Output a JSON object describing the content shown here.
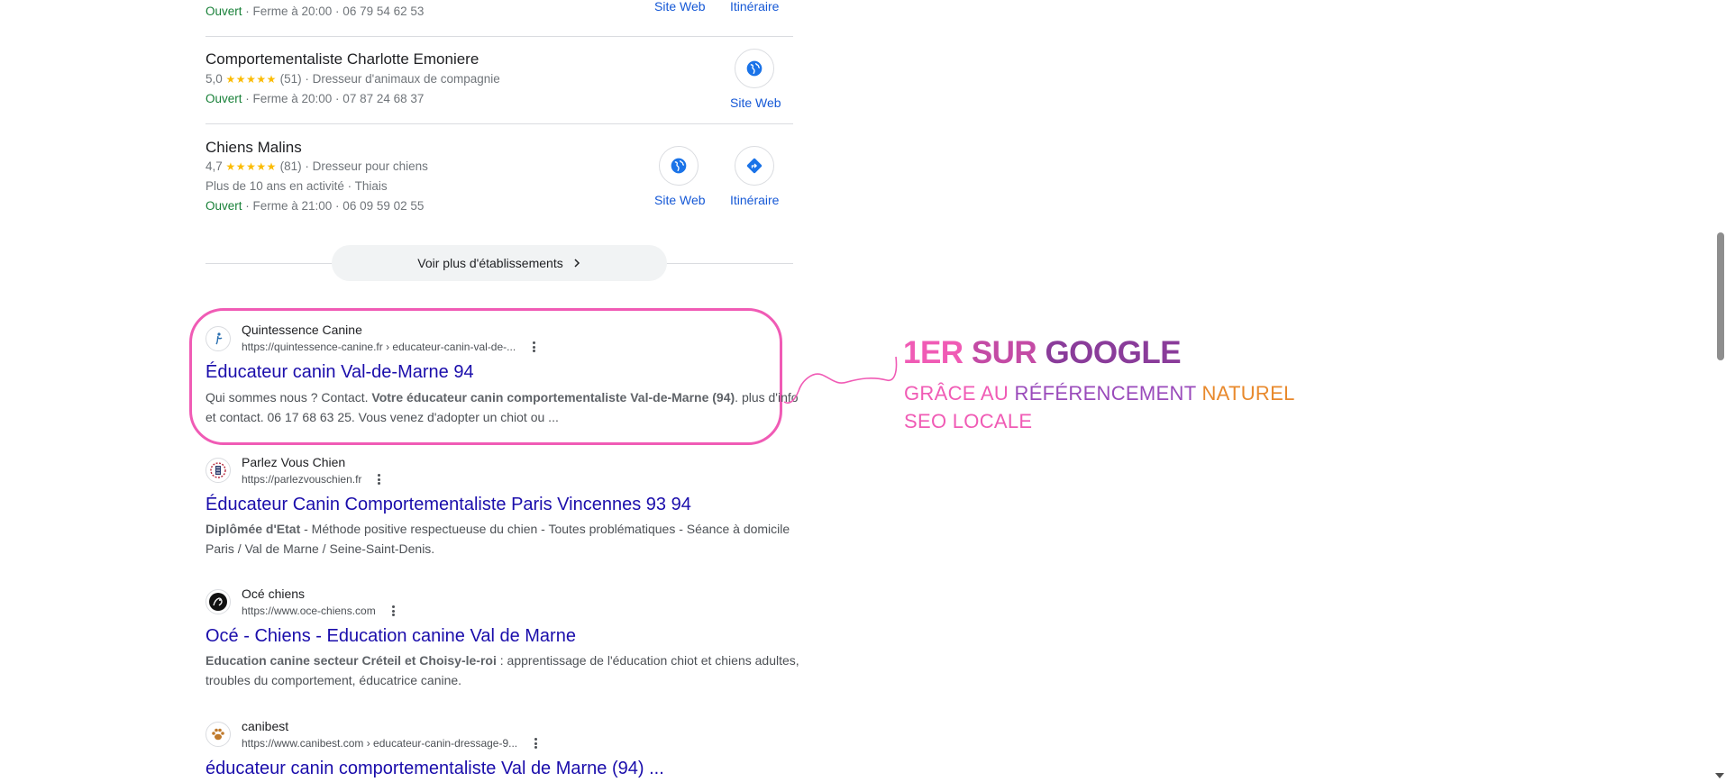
{
  "local_pack": {
    "top_row": {
      "status": "Ouvert",
      "details": " · Ferme à 20:00 · 06 79 54 62 53",
      "site_label": "Site Web",
      "route_label": "Itinéraire"
    },
    "items": [
      {
        "name": "Comportementaliste Charlotte Emoniere",
        "rating": "5,0",
        "stars": "★★★★★",
        "reviews": "(51)",
        "category": " · Dresseur d'animaux de compagnie",
        "status": "Ouvert",
        "details": " · Ferme à 20:00 · 07 87 24 68 37",
        "site_label": "Site Web"
      },
      {
        "name": "Chiens Malins",
        "rating": "4,7",
        "stars": "★★★★★",
        "reviews": "(81)",
        "category": " · Dresseur pour chiens",
        "extra": "Plus de 10 ans en activité · Thiais",
        "status": "Ouvert",
        "details": " · Ferme à 21:00 · 06 09 59 02 55",
        "site_label": "Site Web",
        "route_label": "Itinéraire"
      }
    ],
    "more_label": "Voir plus d'établissements"
  },
  "results": [
    {
      "site": "Quintessence Canine",
      "url": "https://quintessence-canine.fr › educateur-canin-val-de-...",
      "title": "Éducateur canin Val-de-Marne 94",
      "snippet_a": "Qui sommes nous ? Contact. ",
      "snippet_bold": "Votre éducateur canin comportementaliste Val-de-Marne (94)",
      "snippet_b": ". plus d'info et contact. 06 17 68 63 25. Vous venez d'adopter un chiot ou ..."
    },
    {
      "site": "Parlez Vous Chien",
      "url": "https://parlezvouschien.fr",
      "title": "Éducateur Canin Comportementaliste Paris Vincennes 93 94",
      "snippet_bold": "Diplômée d'Etat",
      "snippet_b": " - Méthode positive respectueuse du chien - Toutes problématiques - Séance à domicile Paris / Val de Marne / Seine-Saint-Denis."
    },
    {
      "site": "Océ chiens",
      "url": "https://www.oce-chiens.com",
      "title": "Océ - Chiens - Education canine Val de Marne",
      "snippet_bold": "Education canine secteur Créteil et Choisy-le-roi",
      "snippet_b": " : apprentissage de l'éducation chiot et chiens adultes, troubles du comportement, éducatrice canine."
    },
    {
      "site": "canibest",
      "url": "https://www.canibest.com › educateur-canin-dressage-9...",
      "title": "éducateur canin comportementaliste Val de Marne (94) ..."
    }
  ],
  "promo": {
    "headline_part1": "1ER ",
    "headline_part2": "SUR ",
    "headline_part3": "GOOGLE",
    "line2_a": "GRÂCE AU ",
    "line2_b": "RÉFÉRENCEMENT ",
    "line2_c": "NATUREL",
    "line3": "SEO LOCALE"
  },
  "colors": {
    "link": "#1a0dab",
    "open": "#188038",
    "highlight": "#f05bb5",
    "accent_orange": "#e8892c"
  }
}
